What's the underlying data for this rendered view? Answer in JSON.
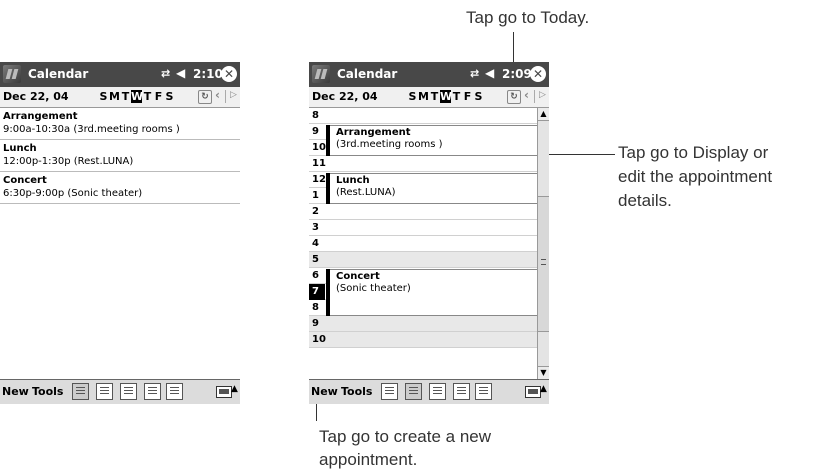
{
  "annotations": {
    "today": "Tap go to Today.",
    "display_line1": "Tap go to Display or",
    "display_line2": "edit the appointment",
    "display_line3": "details.",
    "new_line1": "Tap go to create a new",
    "new_line2": "appointment."
  },
  "screen_left": {
    "title": "Calendar",
    "time": "2:10",
    "date": "Dec 22, 04",
    "days": [
      "S",
      "M",
      "T",
      "W",
      "T",
      "F",
      "S"
    ],
    "active_day": 3,
    "items": [
      {
        "title": "Arrangement",
        "detail": "9:00a-10:30a (3rd.meeting  rooms )"
      },
      {
        "title": "Lunch",
        "detail": "12:00p-1:30p (Rest.LUNA)"
      },
      {
        "title": "Concert",
        "detail": "6:30p-9:00p (Sonic theater)"
      }
    ],
    "menu": {
      "new": "New",
      "tools": "Tools"
    }
  },
  "screen_right": {
    "title": "Calendar",
    "time": "2:09",
    "date": "Dec 22, 04",
    "days": [
      "S",
      "M",
      "T",
      "W",
      "T",
      "F",
      "S"
    ],
    "hours": [
      "8",
      "9",
      "10",
      "11",
      "12",
      "1",
      "2",
      "3",
      "4",
      "5",
      "6",
      "7",
      "8",
      "9",
      "10"
    ],
    "appointments": [
      {
        "title": "Arrangement",
        "detail": "(3rd.meeting  rooms )"
      },
      {
        "title": "Lunch",
        "detail": "(Rest.LUNA)"
      },
      {
        "title": "Concert",
        "detail": "(Sonic theater)"
      }
    ],
    "menu": {
      "new": "New",
      "tools": "Tools"
    }
  }
}
